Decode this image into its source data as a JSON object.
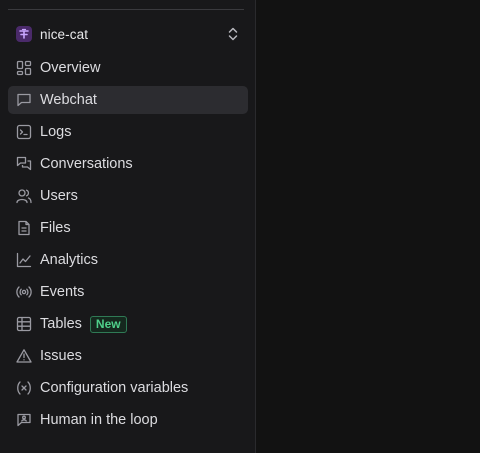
{
  "bot": {
    "name": "nice-cat",
    "avatar_color": "#4a2a6a",
    "avatar_icon": "bot-logo-icon"
  },
  "nav": {
    "items": [
      {
        "label": "Overview",
        "icon": "layout-dashboard-icon"
      },
      {
        "label": "Webchat",
        "icon": "message-square-icon",
        "active": true
      },
      {
        "label": "Logs",
        "icon": "terminal-square-icon"
      },
      {
        "label": "Conversations",
        "icon": "messages-icon"
      },
      {
        "label": "Users",
        "icon": "users-icon"
      },
      {
        "label": "Files",
        "icon": "file-text-icon"
      },
      {
        "label": "Analytics",
        "icon": "line-chart-icon"
      },
      {
        "label": "Events",
        "icon": "radio-icon"
      },
      {
        "label": "Tables",
        "icon": "table-icon",
        "badge": "New"
      },
      {
        "label": "Issues",
        "icon": "alert-triangle-icon"
      },
      {
        "label": "Configuration variables",
        "icon": "variable-icon"
      },
      {
        "label": "Human in the loop",
        "icon": "message-square-user-icon"
      }
    ]
  },
  "colors": {
    "sidebar_bg": "#18181a",
    "main_bg": "#121212",
    "active_item_bg": "#2c2c30",
    "badge_green": "#4fd08a"
  }
}
